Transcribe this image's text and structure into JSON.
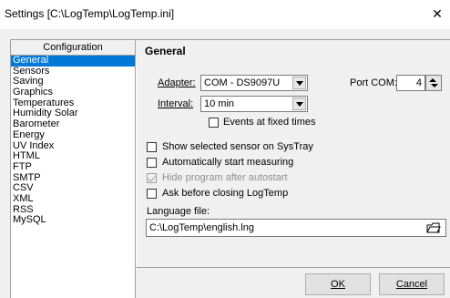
{
  "window": {
    "title": "Settings [C:\\LogTemp\\LogTemp.ini]",
    "close_glyph": "✕"
  },
  "sidebar": {
    "header": "Configuration",
    "items": [
      {
        "label": "General",
        "selected": true
      },
      {
        "label": "Sensors"
      },
      {
        "label": "Saving"
      },
      {
        "label": "Graphics"
      },
      {
        "label": "Temperatures"
      },
      {
        "label": "Humidity Solar"
      },
      {
        "label": "Barometer"
      },
      {
        "label": "Energy"
      },
      {
        "label": "UV Index"
      },
      {
        "label": "HTML"
      },
      {
        "label": "FTP"
      },
      {
        "label": "SMTP"
      },
      {
        "label": "CSV"
      },
      {
        "label": "XML"
      },
      {
        "label": "RSS"
      },
      {
        "label": "MySQL"
      }
    ]
  },
  "panel": {
    "title": "General",
    "adapter": {
      "label": "Adapter:",
      "value": "COM - DS9097U"
    },
    "port_com": {
      "label": "Port COM:",
      "value": "4"
    },
    "interval": {
      "label": "Interval:",
      "value": "10 min"
    },
    "events_fixed_times": {
      "label": "Events at fixed times",
      "checked": false
    },
    "options": [
      {
        "label": "Show selected sensor on SysTray",
        "checked": false,
        "enabled": true
      },
      {
        "label": "Automatically start measuring",
        "checked": false,
        "enabled": true
      },
      {
        "label": "Hide program after autostart",
        "checked": true,
        "enabled": false
      },
      {
        "label": "Ask before closing LogTemp",
        "checked": false,
        "enabled": true
      }
    ],
    "language_file": {
      "label": "Language file:",
      "value": "C:\\LogTemp\\english.lng"
    }
  },
  "buttons": {
    "ok": "OK",
    "cancel": "Cancel"
  },
  "colors": {
    "selection": "#0078d7",
    "dialog_bg": "#f0f0f0"
  }
}
